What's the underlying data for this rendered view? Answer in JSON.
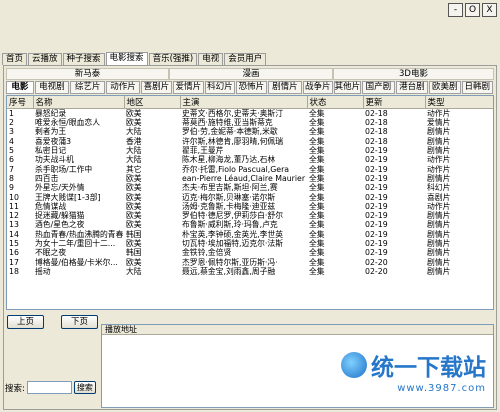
{
  "window": {
    "min": "-",
    "max": "O",
    "close": "X"
  },
  "tabs": [
    "首页",
    "云播放",
    "种子搜索",
    "电影搜索",
    "音乐(强推)",
    "电视",
    "会员用户"
  ],
  "active_tab": 3,
  "groups": [
    "新马泰",
    "漫画",
    "3D电影"
  ],
  "categories": [
    "电影",
    "电视剧",
    "综艺片",
    "动作片",
    "喜剧片",
    "爱情片",
    "科幻片",
    "恐怖片",
    "剧情片",
    "战争片",
    "其他片",
    "国产剧",
    "港台剧",
    "欧美剧",
    "日韩剧"
  ],
  "selected_category": 0,
  "columns": [
    "序号",
    "名称",
    "地区",
    "主演",
    "状态",
    "更新",
    "类型"
  ],
  "rows": [
    [
      "1",
      "暴怒纪录",
      "欧美",
      "史蒂文·西格尔,史蒂夫·奥斯汀",
      "全集",
      "02-18",
      "动作片"
    ],
    [
      "2",
      "唯爱永恒/眼血恋人",
      "欧美",
      "蒂莫西·施特维,亚当斯蒂克",
      "全集",
      "02-18",
      "爱情片"
    ],
    [
      "3",
      "剩者为王",
      "大陆",
      "罗伯·劳,金妮蒂·本德斯,米歇",
      "全集",
      "02-18",
      "剧情片"
    ],
    [
      "4",
      "喜爱夜蒲3",
      "香港",
      "许尔斯,林德肯,廖羽晴,何佩瑞",
      "全集",
      "02-18",
      "剧情片"
    ],
    [
      "5",
      "私密日记",
      "大陆",
      "翟菲,王曼芹",
      "全集",
      "02-19",
      "剧情片"
    ],
    [
      "6",
      "功夫战斗机",
      "大陆",
      "陈木星,柳海龙,董乃达,石林",
      "全集",
      "02-19",
      "动作片"
    ],
    [
      "7",
      "杀手职场/工作中",
      "其它",
      "乔尔·托雷,Fiolo Pascual,Gera",
      "全集",
      "02-19",
      "动作片"
    ],
    [
      "8",
      "四百击",
      "欧美",
      "ean-Pierre Léaud,Claire Maurier",
      "全集",
      "02-19",
      "剧情片"
    ],
    [
      "9",
      "外星忘/天外情",
      "欧美",
      "杰夫·布里吉斯,斯坦·阿兰,赛",
      "全集",
      "02-19",
      "科幻片"
    ],
    [
      "10",
      "王牌大贱谍[1-3部]",
      "欧美",
      "迈克·梅尔斯,贝琳塞·诺尔斯",
      "全集",
      "02-19",
      "喜剧片"
    ],
    [
      "11",
      "危情谋战",
      "欧美",
      "汤姆·克鲁斯,卡梅隆·迪亚兹",
      "全集",
      "02-19",
      "动作片"
    ],
    [
      "12",
      "捉迷藏/躲猫猫",
      "欧美",
      "罗伯特·德尼罗,伊莉莎白·舒尔",
      "全集",
      "02-19",
      "剧情片"
    ],
    [
      "13",
      "酒色/星色之夜",
      "欧美",
      "布鲁斯·威利斯,玲·玛鲁,卢克",
      "全集",
      "02-19",
      "剧情片"
    ],
    [
      "14",
      "热血青春/热血沸腾的青春",
      "韩国",
      "朴宝英,李钟硕,金英光,李世英",
      "全集",
      "02-19",
      "剧情片"
    ],
    [
      "15",
      "为女十二年/重回十二...",
      "欧美",
      "切瓦特·埃加福特,迈克尔·法斯",
      "全集",
      "02-19",
      "剧情片"
    ],
    [
      "16",
      "不眠之夜",
      "韩国",
      "金铁铃,金倍贤",
      "全集",
      "02-19",
      "剧情片"
    ],
    [
      "17",
      "博格曼/伯格曼/卡米尔...",
      "欧美",
      "杰罗恩·佩特尔斯,亚历斯·冯·",
      "全集",
      "02-20",
      "剧情片"
    ],
    [
      "18",
      "摇动",
      "大陆",
      "聂远,蔡金宝,刘雨鑫,周子融",
      "全集",
      "02-20",
      "剧情片"
    ]
  ],
  "buttons": {
    "prev": "上页",
    "next": "下页"
  },
  "play_header": "播放地址",
  "search": {
    "label": "搜索:",
    "value": "",
    "button": "搜索"
  },
  "watermark": {
    "title": "统一下载站",
    "url": "www.3987.com"
  }
}
